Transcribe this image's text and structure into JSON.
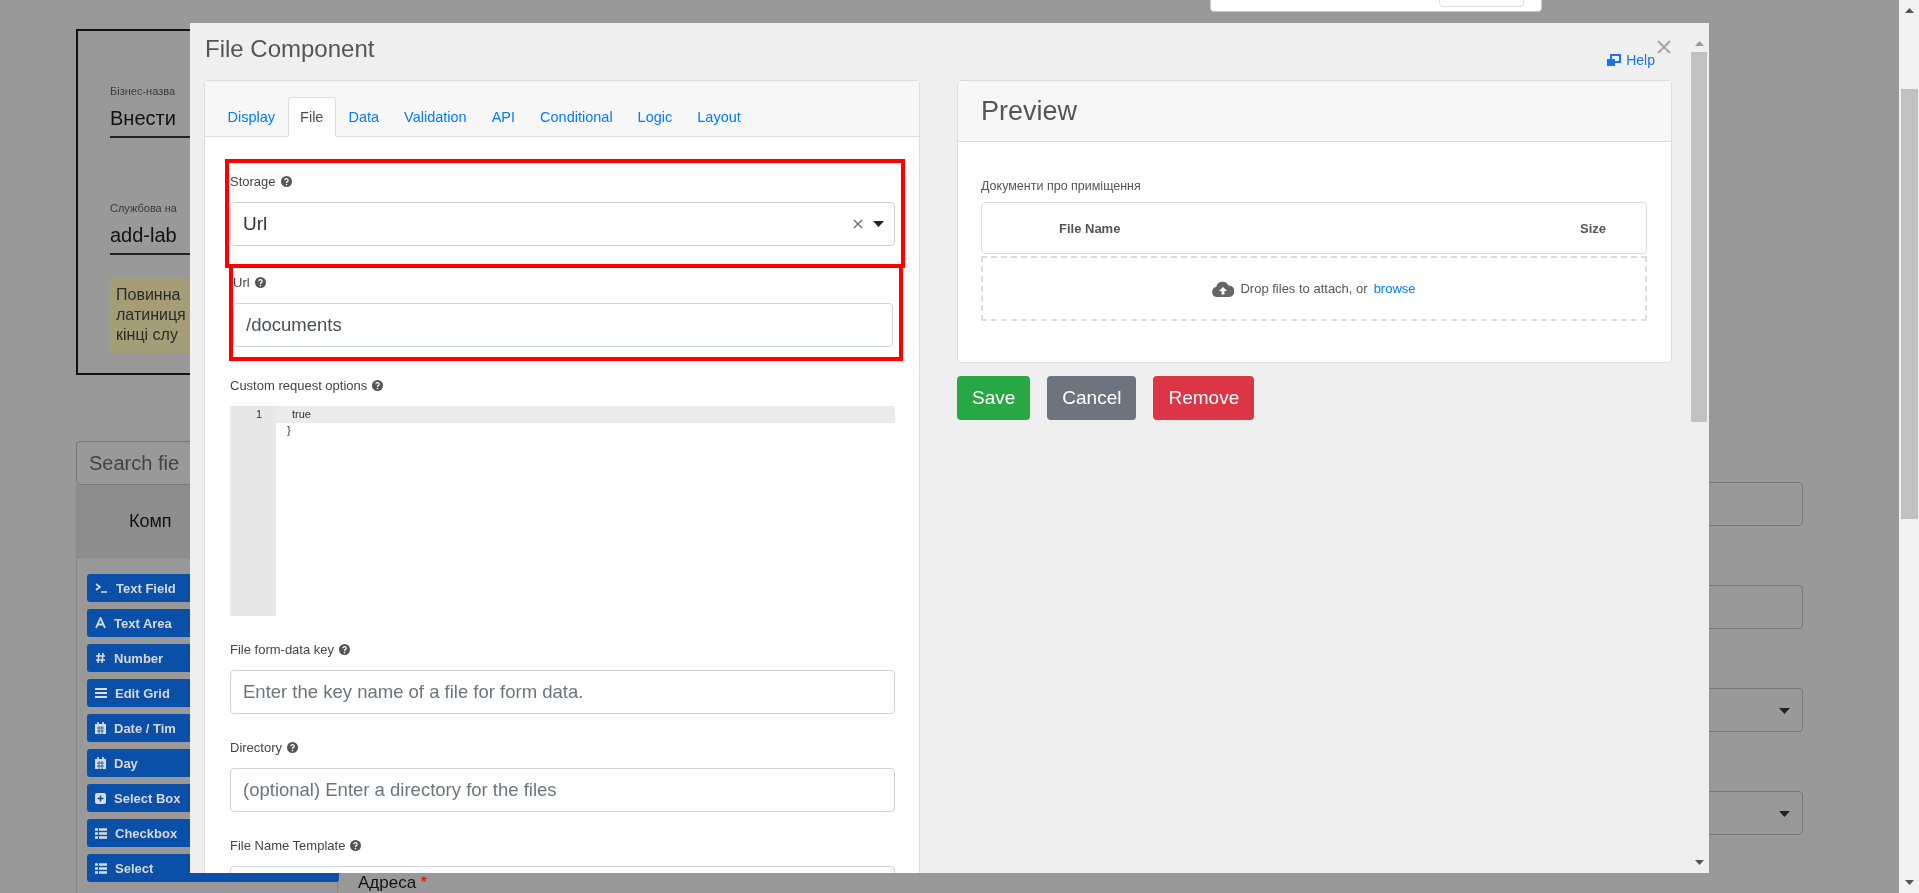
{
  "background_page": {
    "business_name": {
      "label": "Бізнес-назва",
      "value": "Внести"
    },
    "service_name": {
      "label": "Службова на",
      "value": "add-lab"
    },
    "notice_lines": [
      "Повинна",
      "латиниця",
      "кінці слу"
    ],
    "search": {
      "placeholder": "Search fie"
    },
    "components_header": "Комп",
    "components": [
      {
        "kind": "terminal",
        "label": "Text Field"
      },
      {
        "kind": "letter",
        "label": "Text Area"
      },
      {
        "kind": "hash",
        "label": "Number"
      },
      {
        "kind": "table",
        "label": "Edit Grid"
      },
      {
        "kind": "calendar",
        "label": "Date / Tim"
      },
      {
        "kind": "calendar",
        "label": "Day"
      },
      {
        "kind": "plus",
        "label": "Select Box"
      },
      {
        "kind": "list",
        "label": "Checkbox"
      },
      {
        "kind": "list",
        "label": "Select"
      }
    ],
    "fields": [
      {
        "kind": "input"
      },
      {
        "kind": "input"
      },
      {
        "kind": "select"
      },
      {
        "kind": "select"
      }
    ],
    "address_label": "Адреса",
    "required_mark": "*"
  },
  "modal": {
    "title": "File Component",
    "help": "Help",
    "tabs": [
      {
        "label": "Display",
        "selected": false
      },
      {
        "label": "File",
        "selected": true
      },
      {
        "label": "Data",
        "selected": false
      },
      {
        "label": "Validation",
        "selected": false
      },
      {
        "label": "API",
        "selected": false
      },
      {
        "label": "Conditional",
        "selected": false
      },
      {
        "label": "Logic",
        "selected": false
      },
      {
        "label": "Layout",
        "selected": false
      }
    ],
    "storage": {
      "label": "Storage",
      "value": "Url",
      "highlighted": true
    },
    "url": {
      "label": "Url",
      "value": "/documents",
      "highlighted": true
    },
    "custom_request": {
      "label": "Custom request options",
      "line_number": "1",
      "lines": [
        "true",
        "}"
      ]
    },
    "form_data_key": {
      "label": "File form-data key",
      "placeholder": "Enter the key name of a file for form data."
    },
    "directory": {
      "label": "Directory",
      "placeholder": "(optional) Enter a directory for the files"
    },
    "file_name_template": {
      "label": "File Name Template"
    },
    "preview": {
      "title": "Preview",
      "field_label": "Документи про приміщення",
      "columns": [
        "File Name",
        "Size"
      ],
      "drop_text": "Drop files to attach, or",
      "browse": "browse"
    },
    "buttons": [
      {
        "kind": "save",
        "label": "Save"
      },
      {
        "kind": "cancel",
        "label": "Cancel"
      },
      {
        "kind": "remove",
        "label": "Remove"
      }
    ]
  }
}
